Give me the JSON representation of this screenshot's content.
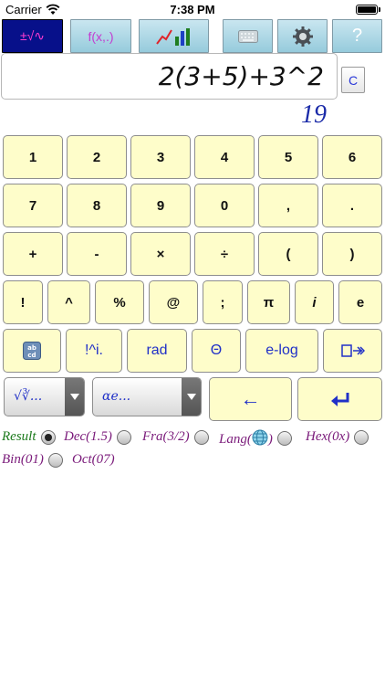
{
  "status_bar": {
    "carrier": "Carrier",
    "time": "7:38 PM"
  },
  "toolbar": {
    "buttons": [
      {
        "name": "math-symbols",
        "label": "±√∿",
        "active": true
      },
      {
        "name": "functions",
        "label": "f(x,.)"
      },
      {
        "name": "graph",
        "icon": "chart-icon"
      },
      {
        "name": "keyboard",
        "icon": "keyboard-icon"
      },
      {
        "name": "settings",
        "icon": "gear-icon"
      },
      {
        "name": "help",
        "label": "?"
      }
    ]
  },
  "display": {
    "expression": "2(3+5)+3^2",
    "result": "19",
    "clear_label": "C"
  },
  "keypad": {
    "row1": [
      "1",
      "2",
      "3",
      "4",
      "5",
      "6"
    ],
    "row2": [
      "7",
      "8",
      "9",
      "0",
      ",",
      "."
    ],
    "row3": [
      "+",
      "-",
      "×",
      "÷",
      "(",
      ")"
    ],
    "row4": [
      "!",
      "^",
      "%",
      "@",
      ";",
      "π",
      "i",
      "e"
    ],
    "row5": [
      "!^i.",
      "rad",
      "Θ",
      "e-log"
    ],
    "row5_icons": [
      "abcd-icon",
      "delete-icon"
    ],
    "row6": {
      "dropdown_roots": "√∛...",
      "dropdown_letters": "αe...",
      "back_label": "←"
    },
    "row6_icons": [
      "return-icon"
    ]
  },
  "modes": {
    "result_label": "Result",
    "options": [
      {
        "label": "Dec(1.5)",
        "selected": false
      },
      {
        "label": "Fra(3/2)",
        "selected": false
      },
      {
        "label": "Lang(",
        "label_end": ")",
        "selected": false
      },
      {
        "label": "Hex(0x)",
        "selected": false
      },
      {
        "label": "Bin(01)",
        "selected": false
      },
      {
        "label": "Oct(07)",
        "selected": false
      }
    ],
    "result_selected": true
  },
  "colors": {
    "key_bg": "#fefdca",
    "toolbar_active": "#07108a",
    "mode_text": "#7a1a7a",
    "result_label": "#1c7a1c",
    "accent_blue": "#2030c8"
  }
}
